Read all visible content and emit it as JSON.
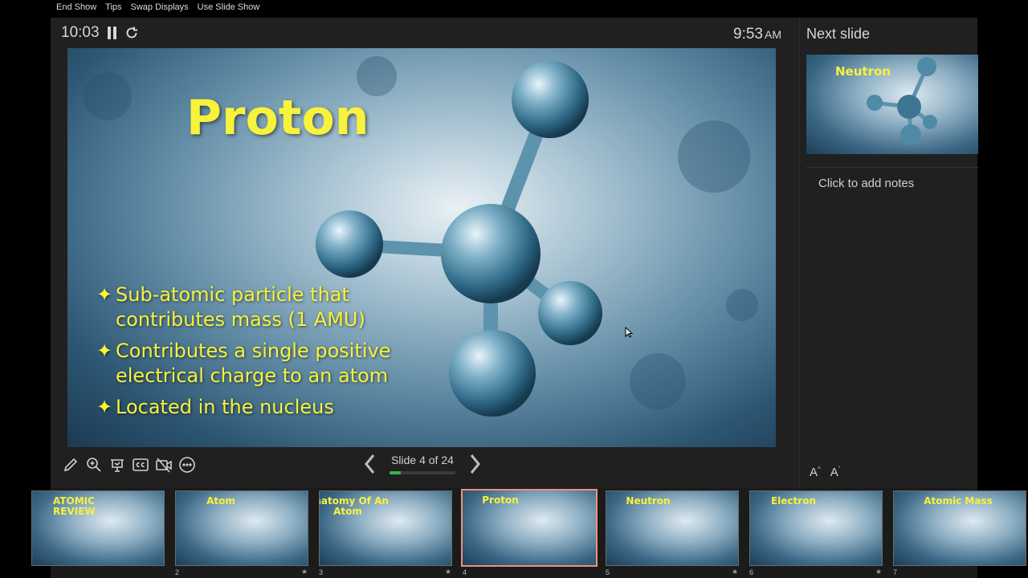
{
  "menu": [
    "End Show",
    "Tips",
    "Swap Displays",
    "Use Slide Show"
  ],
  "timer": {
    "elapsed": "10:03"
  },
  "clock": {
    "time": "9:53",
    "ampm": "AM"
  },
  "current_slide": {
    "title": "Proton",
    "bullets": [
      "Sub-atomic particle that contributes mass (1 AMU)",
      "Contributes a single positive electrical charge to an atom",
      "Located in the nucleus"
    ]
  },
  "navigation": {
    "counter": "Slide 4 of 24",
    "progress": 0.167
  },
  "next_slide": {
    "label": "Next slide",
    "title": "Neutron"
  },
  "notes": {
    "placeholder": "Click to add notes"
  },
  "font_controls": {
    "increase": "A",
    "decrease": "A"
  },
  "filmstrip": [
    {
      "title": "ATOMIC REVIEW",
      "number": "",
      "star": false
    },
    {
      "title": "Atom",
      "number": "2",
      "star": true
    },
    {
      "title": "Anatomy Of An Atom",
      "number": "3",
      "star": true
    },
    {
      "title": "Proton",
      "number": "4",
      "star": false,
      "selected": true
    },
    {
      "title": "Neutron",
      "number": "5",
      "star": true
    },
    {
      "title": "Electron",
      "number": "6",
      "star": true
    },
    {
      "title": "Atomic Mass",
      "number": "7",
      "star": false
    }
  ],
  "icons": [
    "pause-icon",
    "reload-icon",
    "pen-icon",
    "zoom-icon",
    "laser-pointer-icon",
    "captions-icon",
    "camera-off-icon",
    "more-icon",
    "prev-arrow-icon",
    "next-arrow-icon"
  ]
}
